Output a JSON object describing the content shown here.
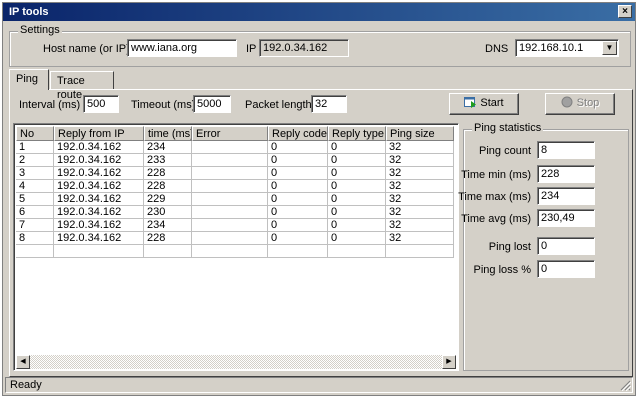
{
  "window": {
    "title": "IP tools",
    "close_glyph": "×"
  },
  "settings": {
    "group_title": "Settings",
    "host_label": "Host name (or IP)",
    "host_value": "www.iana.org",
    "ip_label": "IP",
    "ip_value": "192.0.34.162",
    "dns_label": "DNS",
    "dns_value": "192.168.10.1"
  },
  "tabs": [
    {
      "label": "Ping",
      "active": true
    },
    {
      "label": "Trace route",
      "active": false
    }
  ],
  "ping": {
    "interval_label": "Interval (ms)",
    "interval_value": "500",
    "timeout_label": "Timeout (ms)",
    "timeout_value": "5000",
    "packet_label": "Packet length",
    "packet_value": "32",
    "start_label": "Start",
    "stop_label": "Stop"
  },
  "table": {
    "columns": [
      "No",
      "Reply from IP",
      "time (ms)",
      "Error",
      "Reply code",
      "Reply type",
      "Ping size"
    ],
    "rows": [
      [
        "1",
        "192.0.34.162",
        "234",
        "",
        "0",
        "0",
        "32"
      ],
      [
        "2",
        "192.0.34.162",
        "233",
        "",
        "0",
        "0",
        "32"
      ],
      [
        "3",
        "192.0.34.162",
        "228",
        "",
        "0",
        "0",
        "32"
      ],
      [
        "4",
        "192.0.34.162",
        "228",
        "",
        "0",
        "0",
        "32"
      ],
      [
        "5",
        "192.0.34.162",
        "229",
        "",
        "0",
        "0",
        "32"
      ],
      [
        "6",
        "192.0.34.162",
        "230",
        "",
        "0",
        "0",
        "32"
      ],
      [
        "7",
        "192.0.34.162",
        "234",
        "",
        "0",
        "0",
        "32"
      ],
      [
        "8",
        "192.0.34.162",
        "228",
        "",
        "0",
        "0",
        "32"
      ]
    ]
  },
  "stats": {
    "group_title": "Ping statistics",
    "count_label": "Ping count",
    "count_value": "8",
    "min_label": "Time min (ms)",
    "min_value": "228",
    "max_label": "Time max (ms)",
    "max_value": "234",
    "avg_label": "Time avg (ms)",
    "avg_value": "230,49",
    "lost_label": "Ping lost",
    "lost_value": "0",
    "loss_label": "Ping loss %",
    "loss_value": "0"
  },
  "status": {
    "text": "Ready"
  },
  "colors": {
    "titlebar_start": "#0a246a",
    "titlebar_end": "#3a6ea5",
    "face": "#d4d0c8"
  }
}
